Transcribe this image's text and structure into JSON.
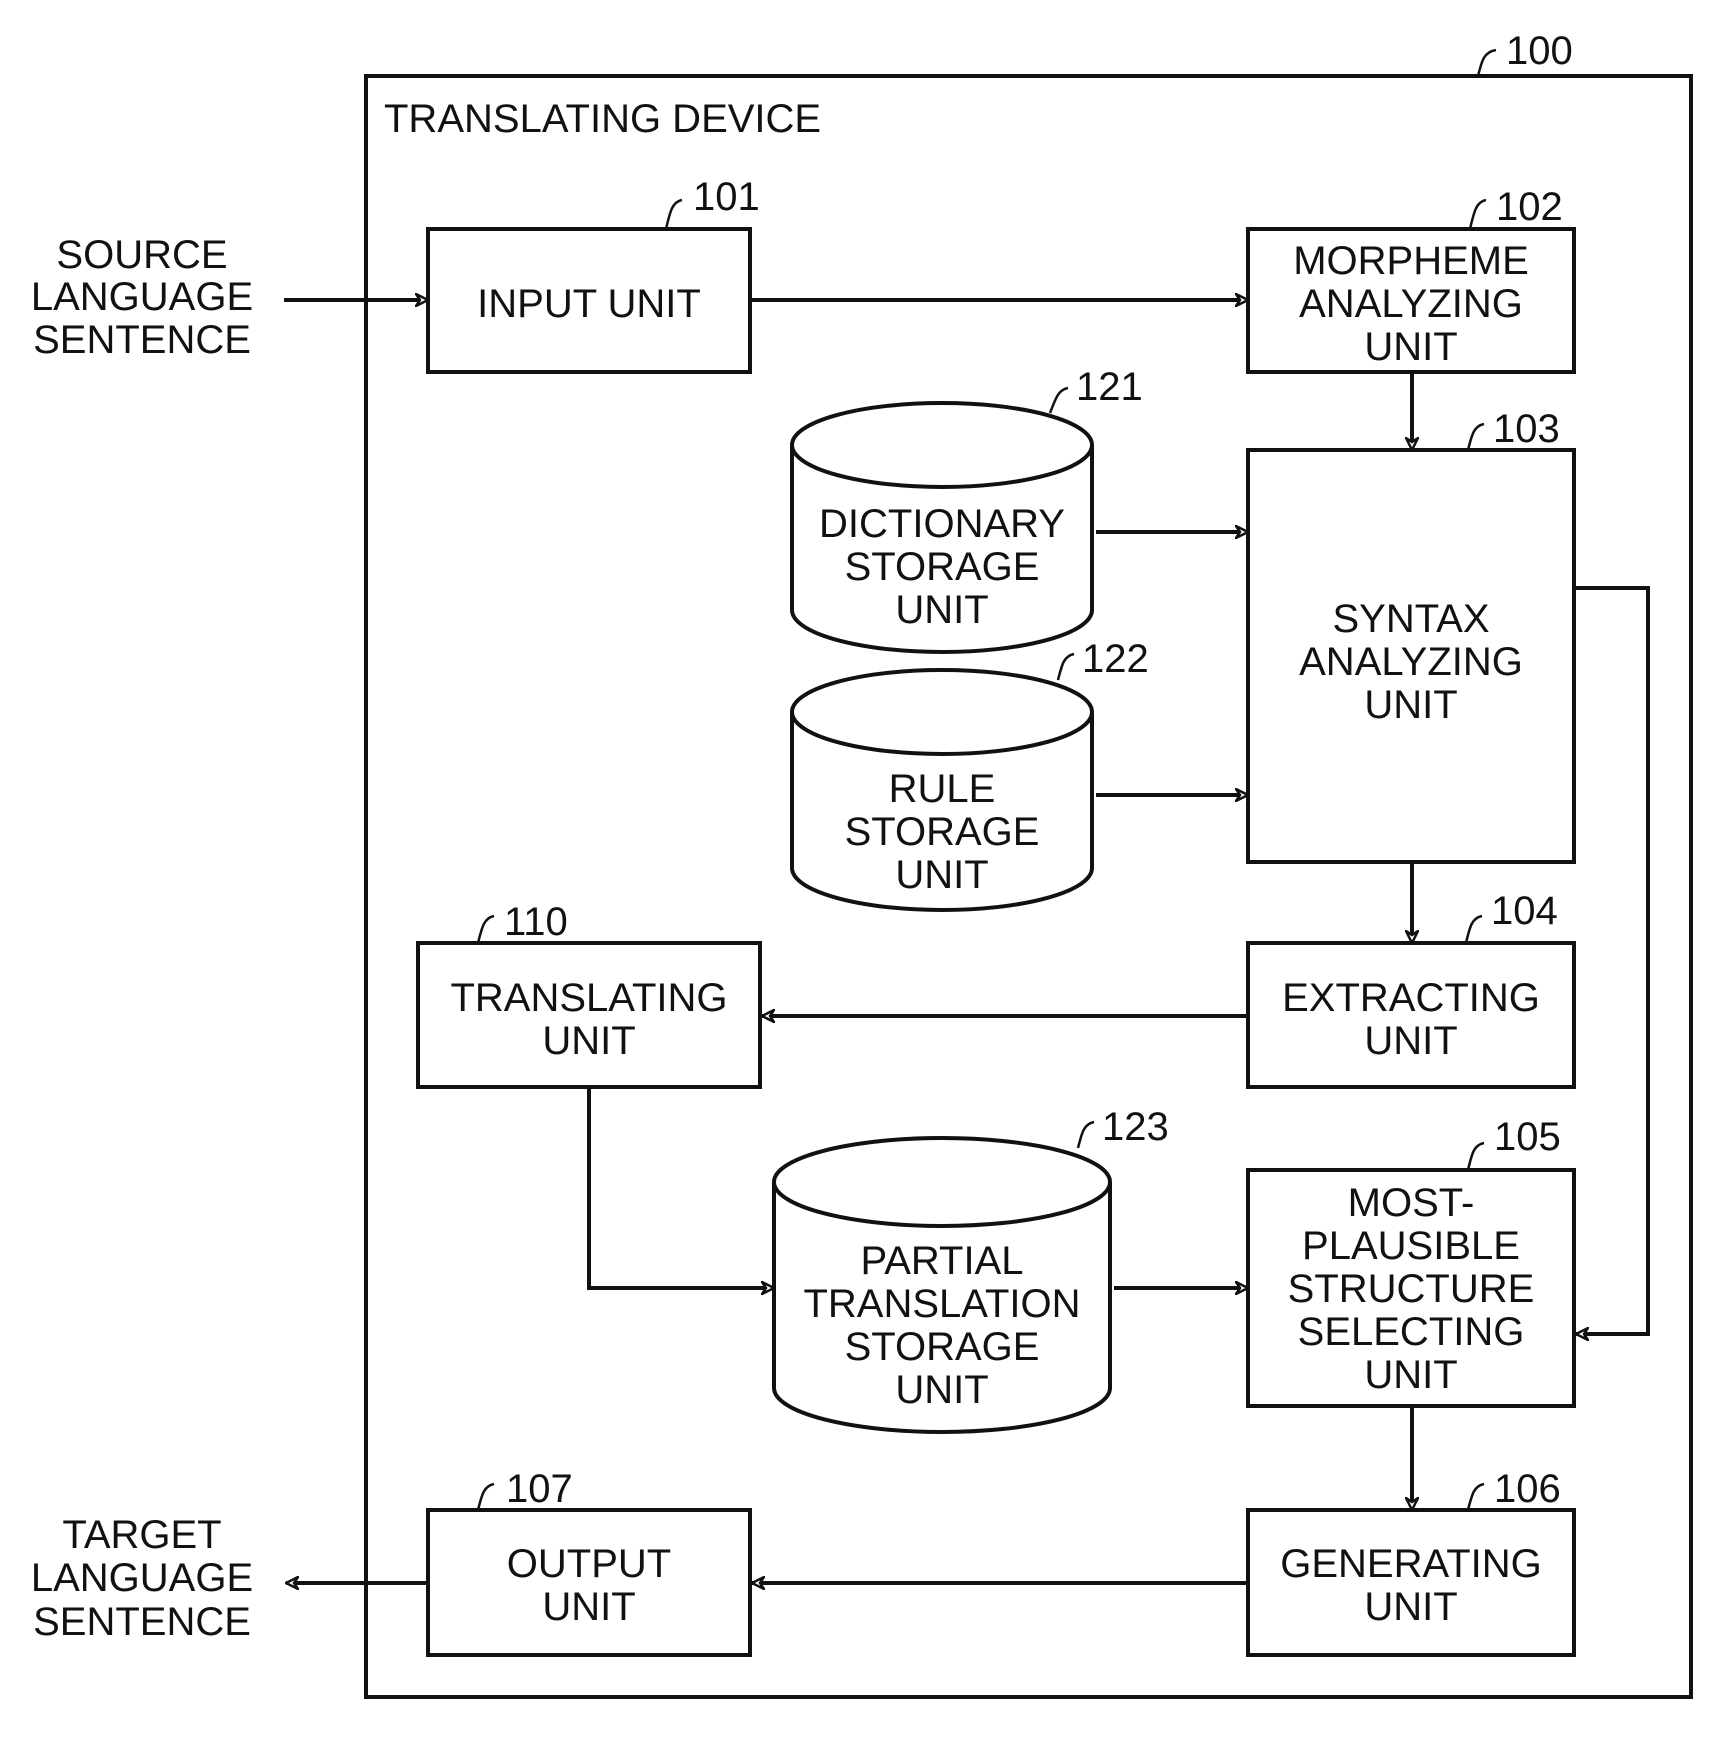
{
  "device": {
    "title": "TRANSLATING DEVICE",
    "ref": "100"
  },
  "external": {
    "source": [
      "SOURCE",
      "LANGUAGE",
      "SENTENCE"
    ],
    "target": [
      "TARGET",
      "LANGUAGE",
      "SENTENCE"
    ]
  },
  "units": {
    "input": {
      "ref": "101",
      "lines": [
        "INPUT UNIT"
      ]
    },
    "morpheme": {
      "ref": "102",
      "lines": [
        "MORPHEME",
        "ANALYZING",
        "UNIT"
      ]
    },
    "syntax": {
      "ref": "103",
      "lines": [
        "SYNTAX",
        "ANALYZING",
        "UNIT"
      ]
    },
    "extracting": {
      "ref": "104",
      "lines": [
        "EXTRACTING",
        "UNIT"
      ]
    },
    "selecting": {
      "ref": "105",
      "lines": [
        "MOST-",
        "PLAUSIBLE",
        "STRUCTURE",
        "SELECTING",
        "UNIT"
      ]
    },
    "generating": {
      "ref": "106",
      "lines": [
        "GENERATING",
        "UNIT"
      ]
    },
    "output": {
      "ref": "107",
      "lines": [
        "OUTPUT",
        "UNIT"
      ]
    },
    "translating": {
      "ref": "110",
      "lines": [
        "TRANSLATING",
        "UNIT"
      ]
    }
  },
  "storages": {
    "dictionary": {
      "ref": "121",
      "lines": [
        "DICTIONARY",
        "STORAGE",
        "UNIT"
      ]
    },
    "rule": {
      "ref": "122",
      "lines": [
        "RULE",
        "STORAGE",
        "UNIT"
      ]
    },
    "partial": {
      "ref": "123",
      "lines": [
        "PARTIAL",
        "TRANSLATION",
        "STORAGE",
        "UNIT"
      ]
    }
  },
  "flows": [
    {
      "from": "source-language-sentence",
      "to": "input-unit"
    },
    {
      "from": "input-unit",
      "to": "morpheme-analyzing-unit"
    },
    {
      "from": "morpheme-analyzing-unit",
      "to": "syntax-analyzing-unit"
    },
    {
      "from": "dictionary-storage-unit",
      "to": "syntax-analyzing-unit"
    },
    {
      "from": "rule-storage-unit",
      "to": "syntax-analyzing-unit"
    },
    {
      "from": "syntax-analyzing-unit",
      "to": "extracting-unit"
    },
    {
      "from": "syntax-analyzing-unit",
      "to": "most-plausible-structure-selecting-unit"
    },
    {
      "from": "extracting-unit",
      "to": "translating-unit"
    },
    {
      "from": "translating-unit",
      "to": "partial-translation-storage-unit"
    },
    {
      "from": "partial-translation-storage-unit",
      "to": "most-plausible-structure-selecting-unit"
    },
    {
      "from": "most-plausible-structure-selecting-unit",
      "to": "generating-unit"
    },
    {
      "from": "generating-unit",
      "to": "output-unit"
    },
    {
      "from": "output-unit",
      "to": "target-language-sentence"
    }
  ]
}
